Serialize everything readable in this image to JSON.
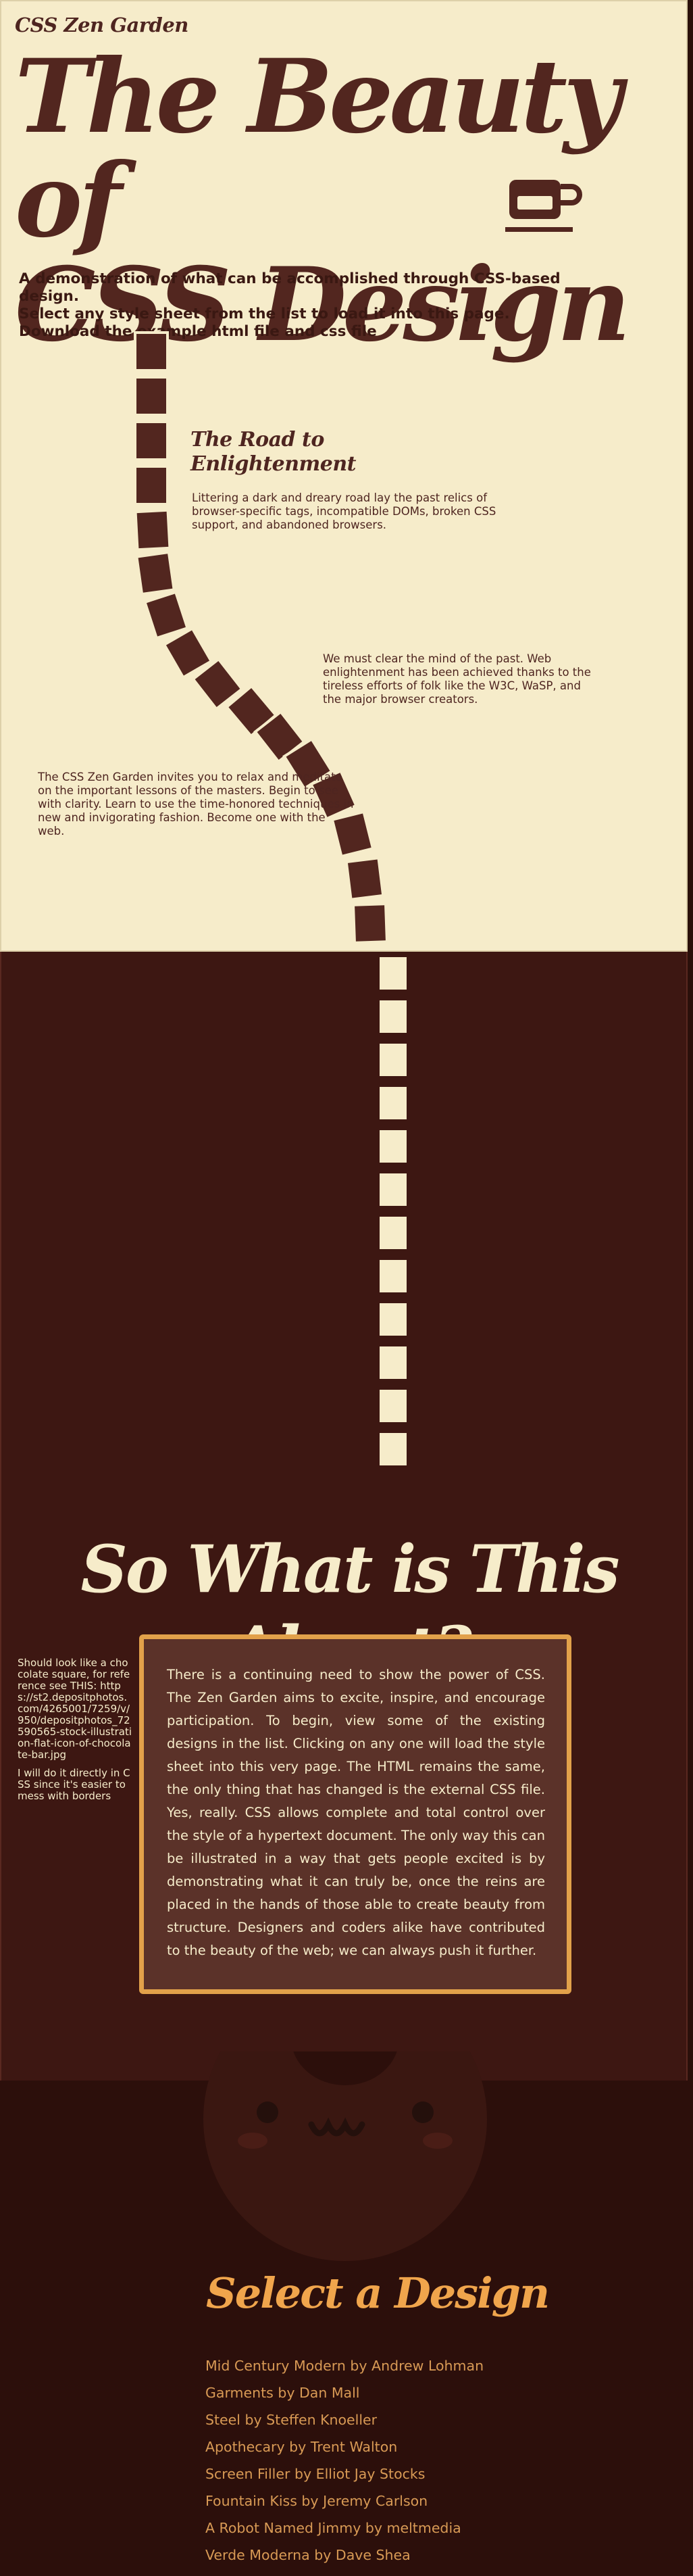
{
  "header": {
    "site_name": "CSS Zen Garden",
    "headline_line1": "The Beauty of",
    "headline_line2": "CSS Design"
  },
  "intro": {
    "line1": "A demonstration of what can be accomplished through CSS-based design.",
    "line2": "Select any style sheet from the list to load it into this page.",
    "line3": "Download the example html file and css file"
  },
  "road": {
    "title": "The Road to Enlightenment",
    "paragraph1": "Littering a dark and dreary road lay the past relics of browser-specific tags, incompatible DOMs, broken CSS support, and abandoned browsers.",
    "paragraph2": "We must clear the mind of the past. Web enlightenment has been achieved thanks to the tireless efforts of folk like the W3C, WaSP, and the major browser creators.",
    "paragraph3": "The CSS Zen Garden invites you to relax and meditate on the important lessons of the masters. Begin to see with clarity. Learn to use the time-honored techniques in new and invigorating fashion. Become one with the web."
  },
  "about": {
    "title": "So What is This About?",
    "side_note_1": "Should look like a chocolate square, for reference see THIS: https://st2.depositphotos.com/4265001/7259/v/950/depositphotos_72590565-stock-illustration-flat-icon-of-chocolate-bar.jpg",
    "side_note_2": "I will do it directly in CSS since it's easier to mess with borders",
    "body": "There is a continuing need to show the power of CSS. The Zen Garden aims to excite, inspire, and encourage participation. To begin, view some of the existing designs in the list. Clicking on any one will load the style sheet into this very page. The HTML remains the same, the only thing that has changed is the external CSS file. Yes, really. CSS allows complete and total control over the style of a hypertext document. The only way this can be illustrated in a way that gets people excited is by demonstrating what it can truly be, once the reins are placed in the hands of those able to create beauty from structure. Designers and coders alike have contributed to the beauty of the web; we can always push it further."
  },
  "select": {
    "title": "Select a Design",
    "designs": [
      {
        "name": "Mid Century Modern",
        "author": "Andrew Lohman"
      },
      {
        "name": "Garments",
        "author": "Dan Mall"
      },
      {
        "name": "Steel",
        "author": "Steffen Knoeller"
      },
      {
        "name": "Apothecary",
        "author": "Trent Walton"
      },
      {
        "name": "Screen Filler",
        "author": "Elliot Jay Stocks"
      },
      {
        "name": "Fountain Kiss",
        "author": "Jeremy Carlson"
      },
      {
        "name": "A Robot Named Jimmy",
        "author": "meltmedia"
      },
      {
        "name": "Verde Moderna",
        "author": "Dave Shea"
      }
    ],
    "by": "by"
  },
  "colors": {
    "cream": "#f6ecca",
    "chocolate": "#52261f",
    "dark_brown": "#3d1712",
    "accent_orange": "#f0a54c"
  },
  "icons": {
    "cup": "coffee-cup-icon",
    "face": "chocolate-face-icon"
  }
}
